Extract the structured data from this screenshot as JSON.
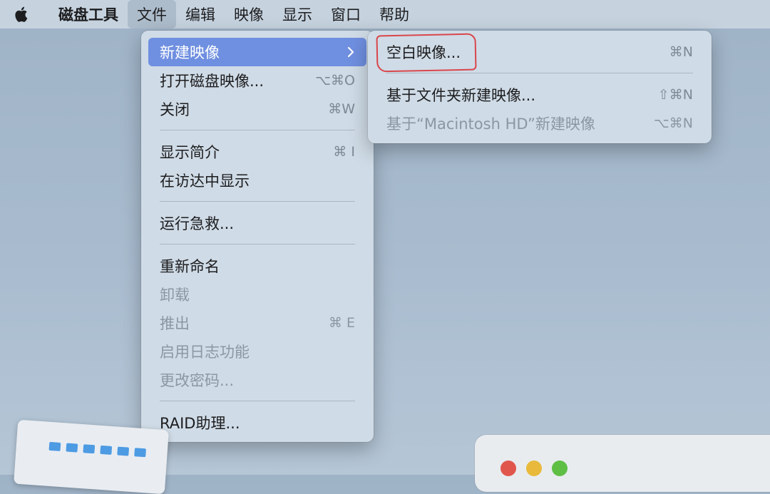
{
  "menubar": {
    "apple_icon": "apple-logo",
    "app_name": "磁盘工具",
    "items": [
      "文件",
      "编辑",
      "映像",
      "显示",
      "窗口",
      "帮助"
    ]
  },
  "file_menu": {
    "new_image": "新建映像",
    "open_image": "打开磁盘映像...",
    "open_image_sc": "⌥⌘O",
    "close": "关闭",
    "close_sc": "⌘W",
    "get_info": "显示简介",
    "get_info_sc": "⌘ I",
    "show_in_finder": "在访达中显示",
    "first_aid": "运行急救...",
    "rename": "重新命名",
    "unmount": "卸载",
    "eject": "推出",
    "eject_sc": "⌘ E",
    "enable_journaling": "启用日志功能",
    "change_password": "更改密码...",
    "raid": "RAID助理..."
  },
  "submenu": {
    "blank_image": "空白映像...",
    "blank_image_sc": "⌘N",
    "from_folder": "基于文件夹新建映像...",
    "from_folder_sc": "⇧⌘N",
    "from_disk": "基于“Macintosh HD”新建映像",
    "from_disk_sc": "⌥⌘N"
  },
  "colors": {
    "highlight": "#6f8fe0",
    "annotation": "#d9464b",
    "traffic_red": "#e0564d",
    "traffic_yellow": "#e8b93a",
    "traffic_green": "#5fbf45"
  }
}
